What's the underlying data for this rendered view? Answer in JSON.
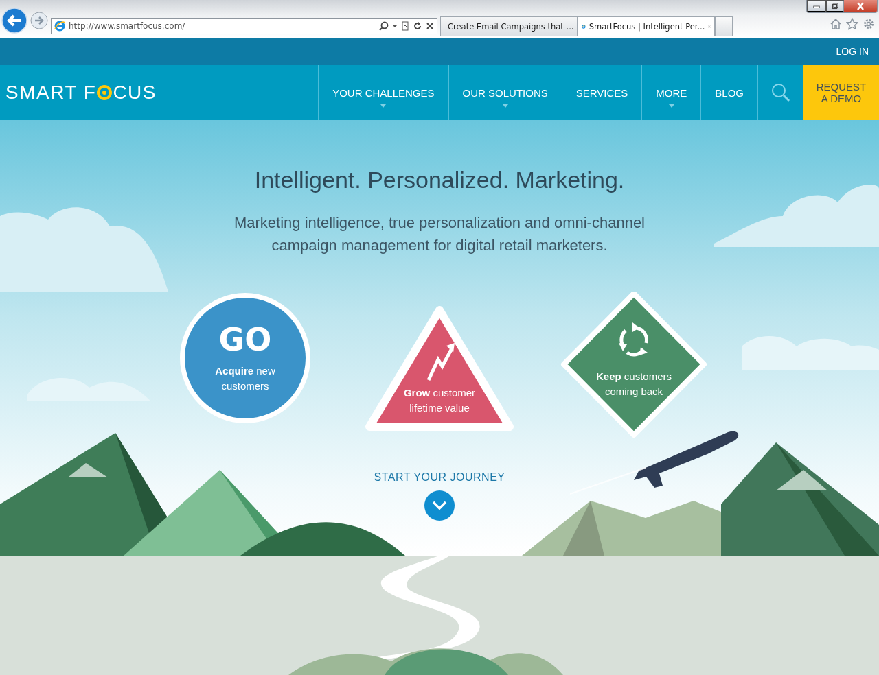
{
  "browser": {
    "address": "http://www.smartfocus.com/",
    "tabs": [
      {
        "title": "Create Email Campaigns that ...",
        "selected": false
      },
      {
        "title": "SmartFocus | Intelligent Per...",
        "selected": true
      }
    ]
  },
  "top_bar": {
    "login": "LOG IN"
  },
  "nav": {
    "logo_start": "SMART F",
    "logo_end": "CUS",
    "items": [
      {
        "label": "YOUR CHALLENGES",
        "dropdown": true
      },
      {
        "label": "OUR SOLUTIONS",
        "dropdown": true
      },
      {
        "label": "SERVICES",
        "dropdown": false
      },
      {
        "label": "MORE",
        "dropdown": true
      },
      {
        "label": "BLOG",
        "dropdown": false
      }
    ],
    "cta": "REQUEST A DEMO"
  },
  "hero": {
    "title": "Intelligent. Personalized. Marketing.",
    "subtitle": "Marketing intelligence, true personalization and omni-channel campaign management for digital retail marketers.",
    "signs": [
      {
        "kind": "circle",
        "headline": "GO",
        "text": "**Acquire** new customers"
      },
      {
        "kind": "triangle",
        "text": "**Grow** customer lifetime value"
      },
      {
        "kind": "diamond",
        "text": "**Keep** customers coming back"
      }
    ],
    "journey": "START YOUR JOURNEY"
  }
}
